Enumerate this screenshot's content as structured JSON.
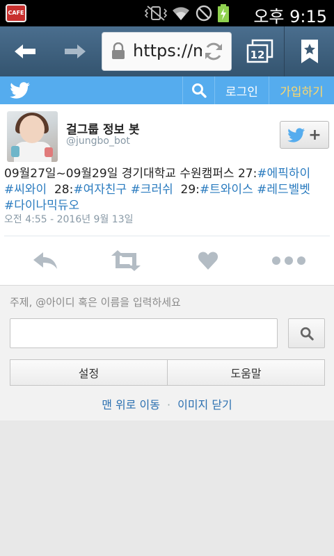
{
  "status_bar": {
    "app_icon_label": "CAFE",
    "time": "오후 9:15"
  },
  "browser": {
    "url": "https://m"
  },
  "twitter_bar": {
    "login": "로그인",
    "join": "가입하기"
  },
  "tweet": {
    "display_name": "걸그룹 정보 봇",
    "screen_name": "@jungbo_bot",
    "text_parts": [
      "09월27일~09월29일 경기대학교 수원캠퍼스 27:",
      "#에픽하이",
      "#씨와이",
      "  28:",
      "#여자친구",
      "#크러쉬",
      "  29:",
      "#트와이스",
      "#레드벨벳",
      "#다이나믹듀오"
    ],
    "timestamp": "오전 4:55 - 2016년 9월 13일"
  },
  "search": {
    "hint": "주제, @아이디 혹은 이름을 입력하세요",
    "value": "",
    "settings": "설정",
    "help": "도움말",
    "top_link": "맨 위로 이동",
    "separator": "·",
    "close_images": "이미지 닫기"
  },
  "colors": {
    "twitter_blue": "#55acee",
    "join_yellow": "#ffd86a",
    "hashtag": "#2a7bbf"
  }
}
